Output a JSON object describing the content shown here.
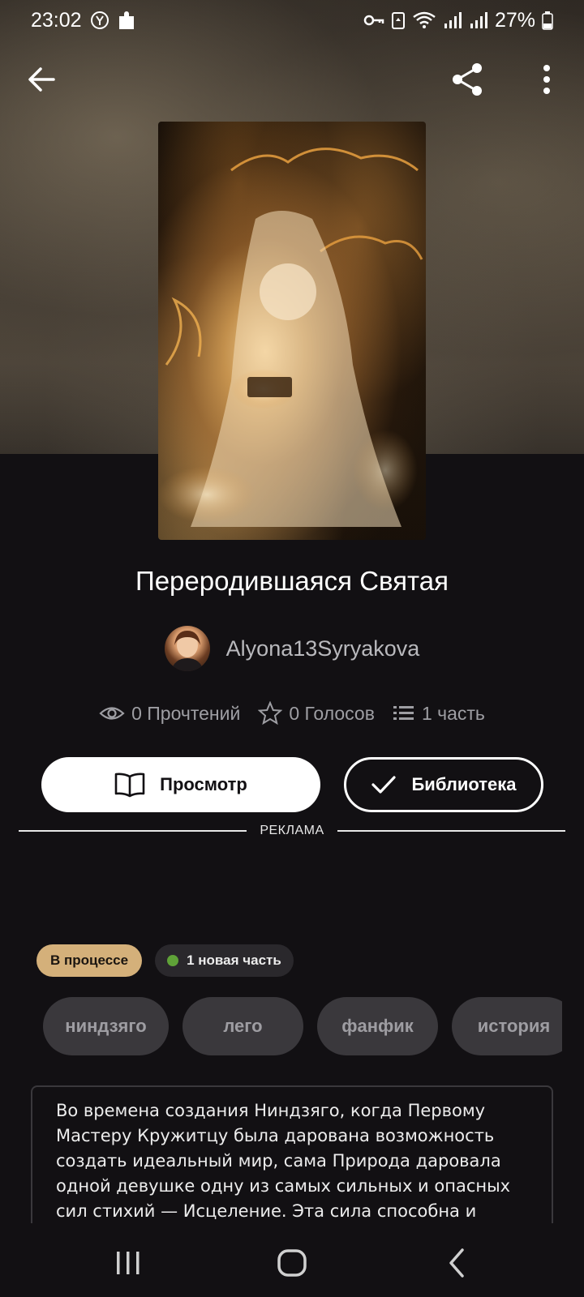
{
  "status_bar": {
    "time": "23:02",
    "battery": "27%",
    "left_icons": [
      "yandex-icon",
      "puzzle-icon"
    ],
    "right_icons": [
      "key-icon",
      "recycle-icon",
      "wifi-icon",
      "signal-icon",
      "signal-icon",
      "battery-icon"
    ]
  },
  "nav": {
    "back_icon": "arrow-left-icon",
    "share_icon": "share-icon",
    "more_icon": "more-vertical-icon"
  },
  "story": {
    "title": "Переродившаяся Святая",
    "author": "Alyona13Syryakova",
    "stats": {
      "reads": "0 Прочтений",
      "votes": "0 Голосов",
      "parts": "1 часть"
    }
  },
  "actions": {
    "view_label": "Просмотр",
    "library_label": "Библиотека"
  },
  "ad": {
    "label": "РЕКЛАМА"
  },
  "badges": {
    "status": "В процессе",
    "new_part": "1 новая часть"
  },
  "tags": [
    "ниндзяго",
    "лего",
    "фанфик",
    "история"
  ],
  "description": "Во времена создания Ниндзяго, когда Первому Мастеру Кружитцу была дарована возможность создать идеальный мир, сама Природа даровала одной девушке одну из самых сильных и опасных сил стихий — Исцеление. Эта сила способна и вернуть к",
  "colors": {
    "background": "#121013",
    "status_badge": "#d4b07a",
    "new_dot": "#5fa238",
    "tag_bg": "#3a383c"
  },
  "system_nav": {
    "recents_icon": "recents-icon",
    "home_icon": "home-icon",
    "back_icon": "system-back-icon"
  }
}
